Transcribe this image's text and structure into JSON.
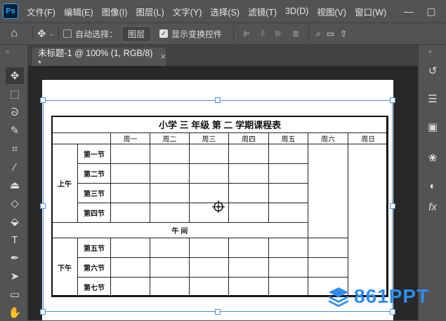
{
  "menubar": {
    "logo": "Ps",
    "items": [
      "文件(F)",
      "编辑(E)",
      "图像(I)",
      "图层(L)",
      "文字(Y)",
      "选择(S)",
      "滤镜(T)",
      "3D(D)",
      "视图(V)",
      "窗口(W)"
    ]
  },
  "options": {
    "auto_select_label": "自动选择：",
    "auto_select_value": "图层",
    "show_transform_label": "显示变换控件"
  },
  "tab": {
    "title": "未标题-1 @ 100% (1, RGB/8) *",
    "close": "×"
  },
  "schedule": {
    "title": "小学 三 年级 第 二 学期课程表",
    "days": [
      "周一",
      "周二",
      "周三",
      "周四",
      "周五",
      "周六",
      "周日"
    ],
    "morning_label": "上午",
    "afternoon_label": "下午",
    "noon_label": "午 间",
    "morning_periods": [
      "第一节",
      "第二节",
      "第三节",
      "第四节"
    ],
    "afternoon_periods": [
      "第五节",
      "第六节",
      "第七节"
    ]
  },
  "watermark": {
    "text": "861PPT"
  },
  "colors": {
    "chrome": "#535353",
    "canvas_bg": "#282828",
    "selection": "#4a90d9",
    "watermark": "#2b8df0"
  }
}
